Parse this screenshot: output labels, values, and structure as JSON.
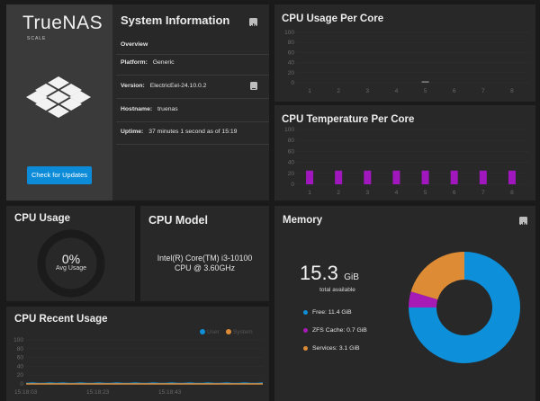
{
  "sysinfo": {
    "logo_text": "TrueNAS",
    "logo_sub": "SCALE",
    "title": "System Information",
    "overview": "Overview",
    "rows": [
      {
        "label": "Platform:",
        "value": "Generic"
      },
      {
        "label": "Version:",
        "value": "ElectricEel-24.10.0.2"
      },
      {
        "label": "Hostname:",
        "value": "truenas"
      },
      {
        "label": "Uptime:",
        "value": "37 minutes 1 second as of 15:19"
      }
    ],
    "update_button": "Check for Updates",
    "icons": {
      "report": "bar-chart-icon",
      "copy": "clipboard-icon"
    }
  },
  "cpu_usage_core": {
    "title": "CPU Usage Per Core",
    "yticks": [
      "100",
      "80",
      "60",
      "40",
      "20",
      "0"
    ],
    "cores": [
      "1",
      "2",
      "3",
      "4",
      "5",
      "6",
      "7",
      "8"
    ]
  },
  "cpu_temp_core": {
    "title": "CPU Temperature Per Core",
    "yticks": [
      "100",
      "80",
      "60",
      "40",
      "20",
      "0"
    ],
    "cores": [
      "1",
      "2",
      "3",
      "4",
      "5",
      "6",
      "7",
      "8"
    ],
    "bar_color": "#a017bd"
  },
  "cpu_usage": {
    "title": "CPU Usage",
    "value": "0%",
    "label": "Avg Usage"
  },
  "cpu_model": {
    "title": "CPU Model",
    "line1": "Intel(R) Core(TM) i3-10100",
    "line2": "CPU @ 3.60GHz"
  },
  "memory": {
    "title": "Memory",
    "total_value": "15.3",
    "total_unit": "GiB",
    "total_label": "total available",
    "legend": [
      {
        "label": "Free:",
        "value": "11.4 GiB",
        "color": "#0d8fd9"
      },
      {
        "label": "ZFS Cache:",
        "value": "0.7 GiB",
        "color": "#a61bb6"
      },
      {
        "label": "Services:",
        "value": "3.1 GiB",
        "color": "#de8b36"
      }
    ]
  },
  "cpu_recent": {
    "title": "CPU Recent Usage",
    "legend_user": "User",
    "legend_system": "System",
    "yticks": [
      "100",
      "80",
      "60",
      "40",
      "20",
      "0"
    ],
    "xticks": [
      "15:18:03",
      "15:18:23",
      "15:18:43"
    ],
    "colors": {
      "user": "#0d8fd9",
      "system": "#de8b36"
    }
  },
  "chart_data": [
    {
      "type": "bar",
      "title": "CPU Usage Per Core",
      "categories": [
        "1",
        "2",
        "3",
        "4",
        "5",
        "6",
        "7",
        "8"
      ],
      "values": [
        0,
        0,
        0,
        0,
        3,
        0,
        0,
        0
      ],
      "ylim": [
        0,
        100
      ]
    },
    {
      "type": "bar",
      "title": "CPU Temperature Per Core",
      "categories": [
        "1",
        "2",
        "3",
        "4",
        "5",
        "6",
        "7",
        "8"
      ],
      "values": [
        25,
        25,
        25,
        25,
        25,
        25,
        25,
        25
      ],
      "ylim": [
        0,
        100
      ]
    },
    {
      "type": "pie",
      "title": "Memory",
      "categories": [
        "Free",
        "ZFS Cache",
        "Services"
      ],
      "values": [
        11.4,
        0.7,
        3.1
      ]
    },
    {
      "type": "line",
      "title": "CPU Recent Usage",
      "x": [
        "15:18:03",
        "15:18:23",
        "15:18:43"
      ],
      "series": [
        {
          "name": "User",
          "values": [
            1,
            2,
            1,
            1,
            2,
            1,
            2,
            1,
            1,
            2,
            1,
            1,
            2,
            1,
            1,
            2,
            1,
            1,
            2,
            1,
            1,
            2,
            1,
            1,
            2,
            1,
            1,
            2,
            1,
            1,
            2,
            1,
            1,
            2,
            1,
            1,
            2,
            1,
            1,
            2
          ]
        },
        {
          "name": "System",
          "values": [
            0,
            0,
            0,
            0,
            0,
            0,
            0,
            0,
            0,
            0,
            0,
            0,
            0,
            0,
            0,
            0,
            0,
            0,
            0,
            0,
            0,
            0,
            0,
            0,
            0,
            0,
            0,
            0,
            0,
            0,
            0,
            0,
            0,
            0,
            0,
            0,
            0,
            0,
            0,
            0
          ]
        }
      ],
      "ylim": [
        0,
        100
      ]
    }
  ]
}
